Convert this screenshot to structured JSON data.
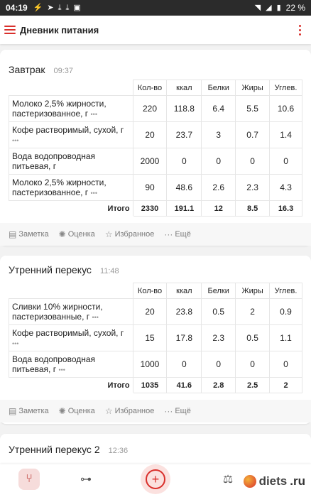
{
  "status_bar": {
    "time": "04:19",
    "battery": "22 %"
  },
  "app_bar": {
    "title": "Дневник питания"
  },
  "columns": [
    "Кол-во",
    "ккал",
    "Белки",
    "Жиры",
    "Углев."
  ],
  "total_label": "Итого",
  "actions": {
    "note": "Заметка",
    "rating": "Оценка",
    "favorite": "Избранное",
    "more": "Ещё"
  },
  "more_dots": "•••",
  "meals": [
    {
      "title": "Завтрак",
      "time": "09:37",
      "items": [
        {
          "name": "Молоко 2,5% жирности, пастеризованное, г",
          "qty": "220",
          "kcal": "118.8",
          "protein": "6.4",
          "fat": "5.5",
          "carbs": "10.6"
        },
        {
          "name": "Кофе растворимый, сухой, г",
          "qty": "20",
          "kcal": "23.7",
          "protein": "3",
          "fat": "0.7",
          "carbs": "1.4"
        },
        {
          "name": "Вода водопроводная питьевая, г",
          "qty": "2000",
          "kcal": "0",
          "protein": "0",
          "fat": "0",
          "carbs": "0"
        },
        {
          "name": "Молоко 2,5% жирности, пастеризованное, г",
          "qty": "90",
          "kcal": "48.6",
          "protein": "2.6",
          "fat": "2.3",
          "carbs": "4.3"
        }
      ],
      "total": {
        "qty": "2330",
        "kcal": "191.1",
        "protein": "12",
        "fat": "8.5",
        "carbs": "16.3"
      }
    },
    {
      "title": "Утренний перекус",
      "time": "11:48",
      "items": [
        {
          "name": "Сливки 10% жирности, пастеризованные, г",
          "qty": "20",
          "kcal": "23.8",
          "protein": "0.5",
          "fat": "2",
          "carbs": "0.9"
        },
        {
          "name": "Кофе растворимый, сухой, г",
          "qty": "15",
          "kcal": "17.8",
          "protein": "2.3",
          "fat": "0.5",
          "carbs": "1.1"
        },
        {
          "name": "Вода водопроводная питьевая, г",
          "qty": "1000",
          "kcal": "0",
          "protein": "0",
          "fat": "0",
          "carbs": "0"
        }
      ],
      "total": {
        "qty": "1035",
        "kcal": "41.6",
        "protein": "2.8",
        "fat": "2.5",
        "carbs": "2"
      }
    },
    {
      "title": "Утренний перекус 2",
      "time": "12:36"
    }
  ],
  "logo": {
    "text": "diets",
    "suffix": ".ru"
  }
}
